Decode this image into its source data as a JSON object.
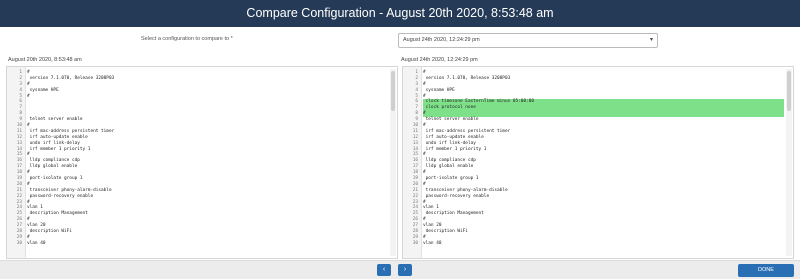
{
  "window": {
    "title": "Compare Configuration - August 20th 2020, 8:53:48 am"
  },
  "selector": {
    "label": "Select a configuration to compare to *",
    "value": "August 24th 2020, 12:24:29 pm",
    "icon": "chevron-down-icon"
  },
  "left_pane": {
    "title": "August 20th 2020, 8:53:48 am",
    "lines": [
      {
        "num": "1",
        "text": "#",
        "style": ""
      },
      {
        "num": "2",
        "text": " version 7.1.070, Release 3208P03",
        "style": ""
      },
      {
        "num": "3",
        "text": "#",
        "style": ""
      },
      {
        "num": "4",
        "text": " sysname HPE",
        "style": ""
      },
      {
        "num": "5",
        "text": "#",
        "style": ""
      },
      {
        "num": "6",
        "text": "",
        "style": "gray"
      },
      {
        "num": "7",
        "text": "",
        "style": "gray"
      },
      {
        "num": "8",
        "text": "",
        "style": "gray"
      },
      {
        "num": "9",
        "text": " telnet server enable",
        "style": ""
      },
      {
        "num": "10",
        "text": "#",
        "style": ""
      },
      {
        "num": "11",
        "text": " irf mac-address persistent timer",
        "style": ""
      },
      {
        "num": "12",
        "text": " irf auto-update enable",
        "style": ""
      },
      {
        "num": "13",
        "text": " undo irf link-delay",
        "style": ""
      },
      {
        "num": "14",
        "text": " irf member 1 priority 1",
        "style": ""
      },
      {
        "num": "15",
        "text": "#",
        "style": ""
      },
      {
        "num": "16",
        "text": " lldp compliance cdp",
        "style": ""
      },
      {
        "num": "17",
        "text": " lldp global enable",
        "style": ""
      },
      {
        "num": "18",
        "text": "#",
        "style": ""
      },
      {
        "num": "19",
        "text": " port-isolate group 1",
        "style": ""
      },
      {
        "num": "20",
        "text": "#",
        "style": ""
      },
      {
        "num": "21",
        "text": " transceiver phony-alarm-disable",
        "style": ""
      },
      {
        "num": "22",
        "text": " password-recovery enable",
        "style": ""
      },
      {
        "num": "23",
        "text": "#",
        "style": ""
      },
      {
        "num": "24",
        "text": "vlan 1",
        "style": ""
      },
      {
        "num": "25",
        "text": " description Management",
        "style": ""
      },
      {
        "num": "26",
        "text": "#",
        "style": ""
      },
      {
        "num": "27",
        "text": "vlan 20",
        "style": ""
      },
      {
        "num": "28",
        "text": " description WiFi",
        "style": ""
      },
      {
        "num": "29",
        "text": "#",
        "style": ""
      },
      {
        "num": "30",
        "text": "vlan 40",
        "style": ""
      }
    ]
  },
  "right_pane": {
    "title": "August 24th 2020, 12:24:29 pm",
    "lines": [
      {
        "num": "1",
        "text": "#",
        "style": ""
      },
      {
        "num": "2",
        "text": " version 7.1.070, Release 3208P03",
        "style": ""
      },
      {
        "num": "3",
        "text": "#",
        "style": ""
      },
      {
        "num": "4",
        "text": " sysname HPE",
        "style": ""
      },
      {
        "num": "5",
        "text": "#",
        "style": ""
      },
      {
        "num": "6",
        "text": " clock timezone EasternTime minus 05:00:00",
        "style": "green"
      },
      {
        "num": "7",
        "text": " clock protocol none",
        "style": "green"
      },
      {
        "num": "8",
        "text": "#",
        "style": "green"
      },
      {
        "num": "9",
        "text": " telnet server enable",
        "style": ""
      },
      {
        "num": "10",
        "text": "#",
        "style": ""
      },
      {
        "num": "11",
        "text": " irf mac-address persistent timer",
        "style": ""
      },
      {
        "num": "12",
        "text": " irf auto-update enable",
        "style": ""
      },
      {
        "num": "13",
        "text": " undo irf link-delay",
        "style": ""
      },
      {
        "num": "14",
        "text": " irf member 1 priority 1",
        "style": ""
      },
      {
        "num": "15",
        "text": "#",
        "style": ""
      },
      {
        "num": "16",
        "text": " lldp compliance cdp",
        "style": ""
      },
      {
        "num": "17",
        "text": " lldp global enable",
        "style": ""
      },
      {
        "num": "18",
        "text": "#",
        "style": ""
      },
      {
        "num": "19",
        "text": " port-isolate group 1",
        "style": ""
      },
      {
        "num": "20",
        "text": "#",
        "style": ""
      },
      {
        "num": "21",
        "text": " transceiver phony-alarm-disable",
        "style": ""
      },
      {
        "num": "22",
        "text": " password-recovery enable",
        "style": ""
      },
      {
        "num": "23",
        "text": "#",
        "style": ""
      },
      {
        "num": "24",
        "text": "vlan 1",
        "style": ""
      },
      {
        "num": "25",
        "text": " description Management",
        "style": ""
      },
      {
        "num": "26",
        "text": "#",
        "style": ""
      },
      {
        "num": "27",
        "text": "vlan 20",
        "style": ""
      },
      {
        "num": "28",
        "text": " description WiFi",
        "style": ""
      },
      {
        "num": "29",
        "text": "#",
        "style": ""
      },
      {
        "num": "30",
        "text": "vlan 40",
        "style": ""
      }
    ]
  },
  "footer": {
    "prev_icon": "chevron-left-icon",
    "next_icon": "chevron-right-icon",
    "prev_glyph": "‹",
    "next_glyph": "›",
    "done_label": "DONE"
  },
  "colors": {
    "titlebar": "#243a57",
    "added_line": "#7fe08a",
    "removed_line": "#c8c8c8",
    "button": "#2a6fb3"
  }
}
